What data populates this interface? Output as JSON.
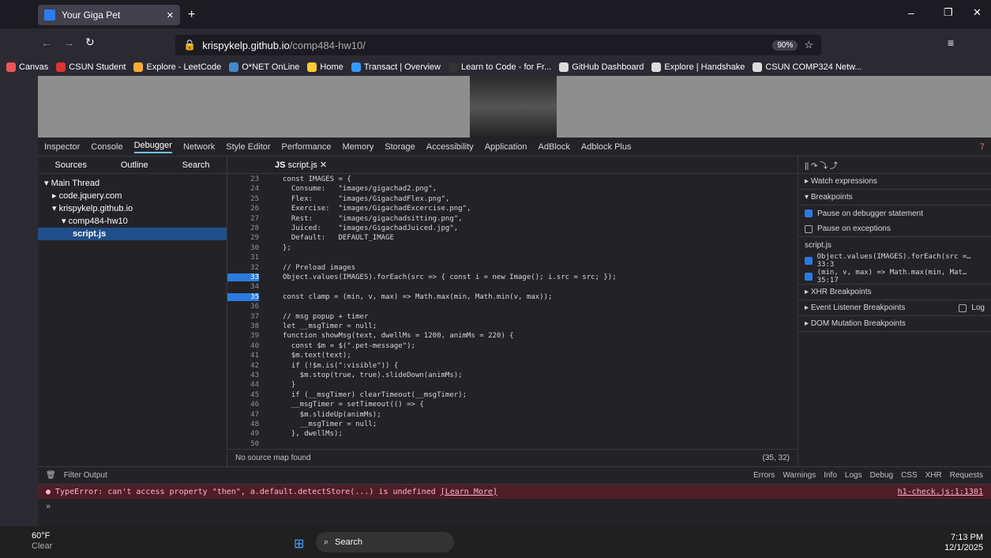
{
  "tab": {
    "title": "Your Giga Pet"
  },
  "url": {
    "host": "krispykelp.github.io",
    "path": "/comp484-hw10/",
    "zoom": "90%"
  },
  "bookmarks": [
    "Canvas",
    "CSUN Student",
    "Explore - LeetCode",
    "O*NET OnLine",
    "Home",
    "Transact | Overview",
    "Learn to Code - for Fr...",
    "GitHub Dashboard",
    "Explore | Handshake",
    "CSUN COMP324 Netw..."
  ],
  "devtools": {
    "tabs": [
      "Inspector",
      "Console",
      "Debugger",
      "Network",
      "Style Editor",
      "Performance",
      "Memory",
      "Storage",
      "Accessibility",
      "Application",
      "AdBlock",
      "Adblock Plus"
    ],
    "error_count": "7"
  },
  "sources": {
    "tabs": [
      "Sources",
      "Outline",
      "Search"
    ],
    "tree": [
      "Main Thread",
      "code.jquery.com",
      "krispykelp.github.io",
      "comp484-hw10",
      "script.js"
    ]
  },
  "editor": {
    "tab": "script.js",
    "lines": [
      {
        "n": "23",
        "c": "const IMAGES = {"
      },
      {
        "n": "24",
        "c": "  Consume:   \"images/gigachad2.png\","
      },
      {
        "n": "25",
        "c": "  Flex:      \"images/GigachadFlex.png\","
      },
      {
        "n": "26",
        "c": "  Exercise:  \"images/GigachadExcercise.png\","
      },
      {
        "n": "27",
        "c": "  Rest:      \"images/gigachadsitting.png\","
      },
      {
        "n": "28",
        "c": "  Juiced:    \"images/GigachadJuiced.jpg\","
      },
      {
        "n": "29",
        "c": "  Default:   DEFAULT_IMAGE"
      },
      {
        "n": "30",
        "c": "};"
      },
      {
        "n": "31",
        "c": ""
      },
      {
        "n": "32",
        "c": "// Preload images"
      },
      {
        "n": "33",
        "c": "Object.values(IMAGES).forEach(src => { const i = new Image(); i.src = src; });"
      },
      {
        "n": "34",
        "c": ""
      },
      {
        "n": "35",
        "c": "const clamp = (min, v, max) => Math.max(min, Math.min(v, max));"
      },
      {
        "n": "36",
        "c": ""
      },
      {
        "n": "37",
        "c": "// msg popup + timer"
      },
      {
        "n": "38",
        "c": "let __msgTimer = null;"
      },
      {
        "n": "39",
        "c": "function showMsg(text, dwellMs = 1200, animMs = 220) {"
      },
      {
        "n": "40",
        "c": "  const $m = $(\".pet-message\");"
      },
      {
        "n": "41",
        "c": "  $m.text(text);"
      },
      {
        "n": "42",
        "c": "  if (!$m.is(\":visible\")) {"
      },
      {
        "n": "43",
        "c": "    $m.stop(true, true).slideDown(animMs);"
      },
      {
        "n": "44",
        "c": "  }"
      },
      {
        "n": "45",
        "c": "  if (__msgTimer) clearTimeout(__msgTimer);"
      },
      {
        "n": "46",
        "c": "  __msgTimer = setTimeout(() => {"
      },
      {
        "n": "47",
        "c": "    $m.slideUp(animMs);"
      },
      {
        "n": "48",
        "c": "    __msgTimer = null;"
      },
      {
        "n": "49",
        "c": "  }, dwellMs);"
      },
      {
        "n": "50",
        "c": ""
      }
    ],
    "status": "No source map found",
    "pos": "(35, 32)"
  },
  "right": {
    "watch": "Watch expressions",
    "breakpoints": "Breakpoints",
    "pause_dbg": "Pause on debugger statement",
    "pause_exc": "Pause on exceptions",
    "file": "script.js",
    "bp1": "Object.values(IMAGES).forEach(src =… 33:3",
    "bp2": "(min, v, max) => Math.max(min, Mat… 35:17",
    "xhr": "XHR Breakpoints",
    "event": "Event Listener Breakpoints",
    "log": "Log",
    "dom": "DOM Mutation Breakpoints"
  },
  "console": {
    "filter": "Filter Output",
    "levels": [
      "Errors",
      "Warnings",
      "Info",
      "Logs",
      "Debug"
    ],
    "extra": [
      "CSS",
      "XHR",
      "Requests"
    ],
    "error": "TypeError: can't access property \"then\", a.default.detectStore(...) is undefined",
    "learn": "[Learn More]",
    "loc": "h1-check.js:1:1301"
  },
  "taskbar": {
    "temp": "60°F",
    "weather": "Clear",
    "search": "Search",
    "time": "7:13 PM",
    "date": "12/1/2025"
  }
}
